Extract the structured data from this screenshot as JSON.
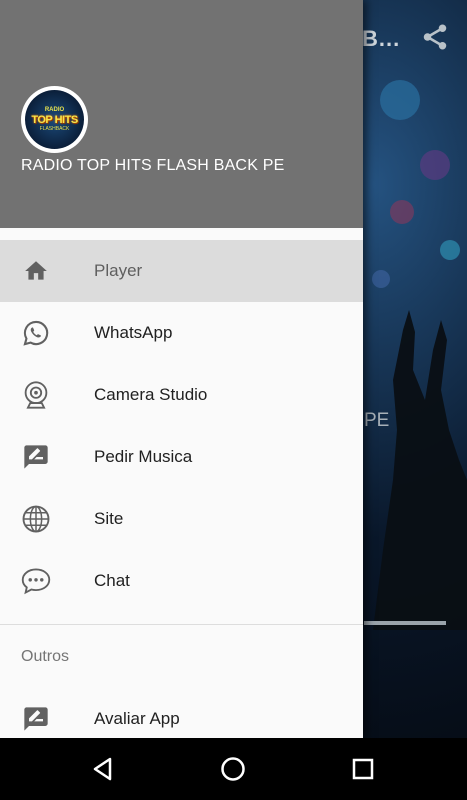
{
  "app": {
    "background_title": "B...",
    "background_subtitle": "PE"
  },
  "drawer": {
    "station_name": "RADIO TOP HITS FLASH BACK PE",
    "logo": {
      "top_text": "RADIO",
      "main_text": "TOP HITS",
      "bottom_text": "FLASHBACK"
    },
    "items": [
      {
        "label": "Player",
        "icon": "home-icon",
        "active": true
      },
      {
        "label": "WhatsApp",
        "icon": "whatsapp-icon",
        "active": false
      },
      {
        "label": "Camera Studio",
        "icon": "webcam-icon",
        "active": false
      },
      {
        "label": "Pedir Musica",
        "icon": "rate-review-icon",
        "active": false
      },
      {
        "label": "Site",
        "icon": "globe-icon",
        "active": false
      },
      {
        "label": "Chat",
        "icon": "chat-bubble-icon",
        "active": false
      }
    ],
    "section_other": "Outros",
    "other_items": [
      {
        "label": "Avaliar App",
        "icon": "rate-review-icon"
      }
    ]
  },
  "navbar": {
    "back": "back-icon",
    "home": "home-circle-icon",
    "recents": "recents-icon"
  },
  "colors": {
    "header_bg": "#727272",
    "active_item_bg": "#dcdcdc",
    "drawer_bg": "#fafafa",
    "icon_color": "#616161"
  }
}
